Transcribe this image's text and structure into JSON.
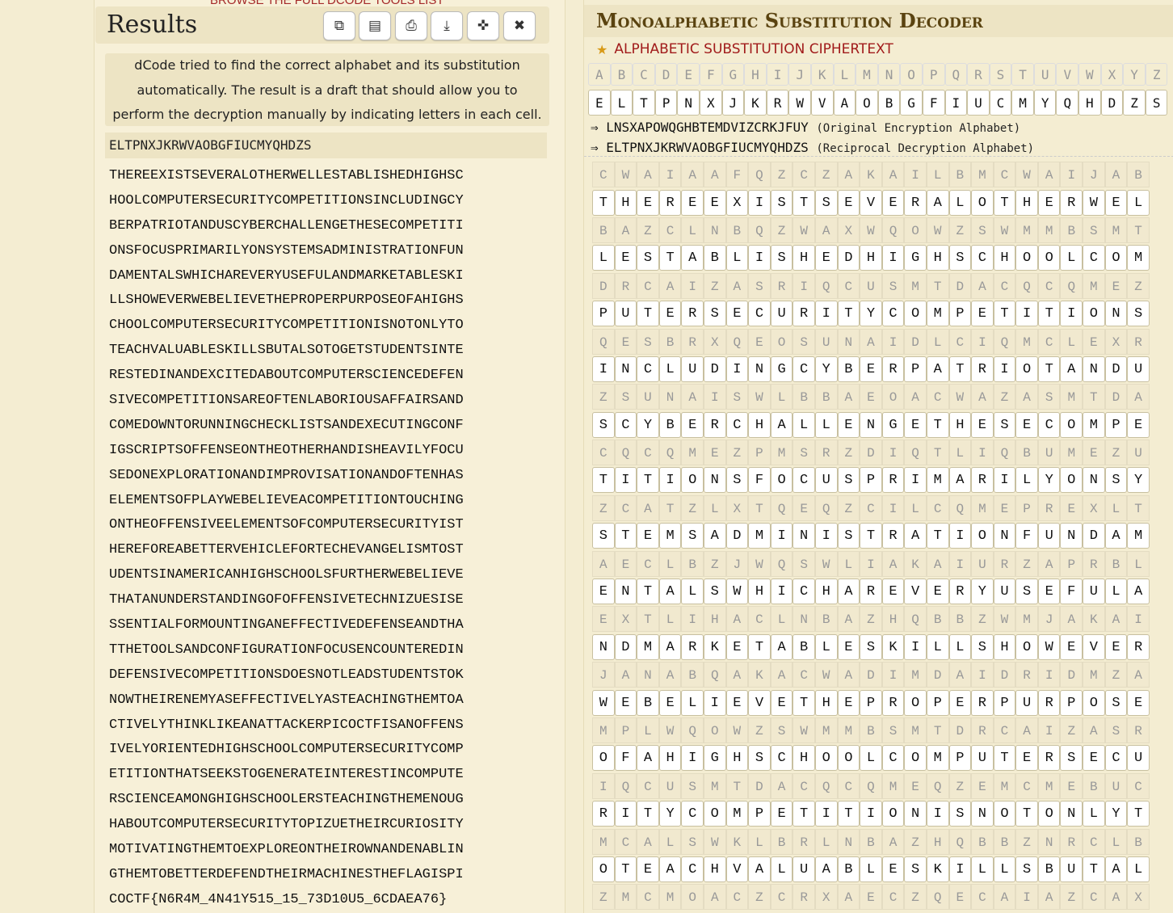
{
  "top_strip": "BROWSE THE FULL DCODE TOOLS LIST",
  "results": {
    "title": "Results",
    "buttons": [
      {
        "name": "copy",
        "glyph": "⧉"
      },
      {
        "name": "save",
        "glyph": "▤"
      },
      {
        "name": "print",
        "glyph": "⎙"
      },
      {
        "name": "download",
        "glyph": "⤓"
      },
      {
        "name": "pin",
        "glyph": "✜"
      },
      {
        "name": "close",
        "glyph": "✖"
      }
    ],
    "notice": "dCode tried to find the correct alphabet and its substitution automatically. The result is a draft that should allow you to perform the decryption manually by indicating letters in each cell.",
    "key": "ELTPNXJKRWVAOBGFIUCMYQHDZS",
    "lines": [
      "THEREEXISTSEVERALOTHERWELLESTABLISHEDHIGHSC",
      "HOOLCOMPUTERSECURITYCOMPETITIONSINCLUDINGCY",
      "BERPATRIOTANDUSCYBERCHALLENGETHESECOMPETITI",
      "ONSFOCUSPRIMARILYONSYSTEMSADMINISTRATIONFUN",
      "DAMENTALSWHICHAREVERYUSEFULANDMARKETABLESKI",
      "LLSHOWEVERWEBELIEVETHEPROPERPURPOSEOFAHIGHS",
      "CHOOLCOMPUTERSECURITYCOMPETITIONISNOTONLYTO",
      "TEACHVALUABLESKILLSBUTALSOTOGETSTUDENTSINTE",
      "RESTEDINANDEXCITEDABOUTCOMPUTERSCIENCEDEFEN",
      "SIVECOMPETITIONSAREOFTENLABORIOUSAFFAIRSAND",
      "COMEDOWNTORUNNINGCHECKLISTSANDEXECUTINGCONF",
      "IGSCRIPTSOFFENSEONTHEOTHERHANDISHEAVILYFOCU",
      "SEDONEXPLORATIONANDIMPROVISATIONANDOFTENHAS",
      "ELEMENTSOFPLAYWEBELIEVEACOMPETITIONTOUCHING",
      "ONTHEOFFENSIVEELEMENTSOFCOMPUTERSECURITYIST",
      "HEREFOREABETTERVEHICLEFORTECHEVANGELISMTOST",
      "UDENTSINAMERICANHIGHSCHOOLSFURTHERWEBELIEVE",
      "THATANUNDERSTANDINGOFOFFENSIVETECHNIZUESISE",
      "SSENTIALFORMOUNTINGANEFFECTIVEDEFENSEANDTHA",
      "TTHETOOLSANDCONFIGURATIONFOCUSENCOUNTEREDIN",
      "DEFENSIVECOMPETITIONSDOESNOTLEADSTUDENTSTOK",
      "NOWTHEIRENEMYASEFFECTIVELYASTEACHINGTHEMTOA",
      "CTIVELYTHINKLIKEANATTACKERPICOCTFISANOFFENS",
      "IVELYORIENTEDHIGHSCHOOLCOMPUTERSECURITYCOMP",
      "ETITIONTHATSEEKSTOGENERATEINTERESTINCOMPUTE",
      "RSCIENCEAMONGHIGHSCHOOLERSTEACHINGTHEMENOUG",
      "HABOUTCOMPUTERSECURITYTOPIZUETHEIRCURIOSITY",
      "MOTIVATINGTHEMTOEXPLOREONTHEIROWNANDENABLIN",
      "GTHEMTOBETTERDEFENDTHEIRMACHINESTHEFLAGISPI",
      "COCTF{N6R4M_4N41Y515_15_73D10U5_6CDAEA76}"
    ]
  },
  "decoder": {
    "title": "Monoalphabetic Substitution Decoder",
    "section": "ALPHABETIC SUBSTITUTION CIPHERTEXT",
    "alphabet": "ABCDEFGHIJKLMNOPQRSTUVWXYZ",
    "key": "ELTPNXJKRWVAOBGFIUCMYQHDZS",
    "orig_key": "LNSXAPOWQGHBTEMDVIZCRKJFUY",
    "orig_note": "(Original Encryption Alphabet)",
    "recip_key": "ELTPNXJKRWVAOBGFIUCMYQHDZS",
    "recip_note": "(Reciprocal Decryption Alphabet)",
    "rows": [
      {
        "c": "CWAIAAFQZCZAKAILBMCWAIJAB",
        "p": "THEREEXISTSEVERALOTHERWEL"
      },
      {
        "c": "BAZCLNBQZWAXWQOWZSWMMBSMT",
        "p": "LESTABLISHEDHIGHSCHOOLCOM"
      },
      {
        "c": "DRCAIZASRIQCUSMTDACQCQMEZ",
        "p": "PUTERSECURITYCOMPETITIONS"
      },
      {
        "c": "QESBRXQEOSUNAIDLCIQMCLEXR",
        "p": "INCLUDINGCYBERPATRIOTANDU"
      },
      {
        "c": "ZSUNAISWLBBAEOACWAZASMTDA",
        "p": "SCYBERCHALLENGETHESECOMPE"
      },
      {
        "c": "CQCQMEZPMSRZDIQTLIQBUMEZU",
        "p": "TITIONSFOCUSPRIMARILYONSY"
      },
      {
        "c": "ZCATZLXTQEQZCILCQMEPREXLT",
        "p": "STEMSADMINISTRATIONFUNDAM"
      },
      {
        "c": "AECLBZJWQSWLIAKAIURZAPRBL",
        "p": "ENTALSWHICHAREVERYUSEFULA"
      },
      {
        "c": "EXTLIHACLNBAZHQBBZWMJAKAI",
        "p": "NDMARKETABLESKILLSHOWEVER"
      },
      {
        "c": "JANABQAKACWADIMDAIDRIDMZA",
        "p": "WEBELIEVETHEPROPERPURPOSE"
      },
      {
        "c": "MPLWQOWZSWMMBSMTDRCAIZASR",
        "p": "OFAHIGHSCHOOLCOMPUTERSECU"
      },
      {
        "c": "IQCUSMTDACQCQMEQZEMCMEBUC",
        "p": "RITYCOMPETITIONISNOTONLYT"
      },
      {
        "c": "MCALSWKLBRLNBAZHQBBZNRCLB",
        "p": "OTEACHVALUABLESKILLSBUTAL"
      },
      {
        "c": "ZMCMOACZCRXAECZQECAIAZCAX",
        "p": ""
      }
    ]
  }
}
